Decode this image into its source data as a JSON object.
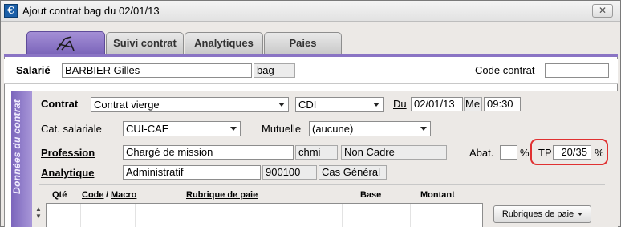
{
  "window": {
    "title": "Ajout contrat bag du 02/01/13",
    "icon_char": "€",
    "close_char": "✕"
  },
  "tabs": [
    {
      "label": "",
      "icon": "deckchair-icon"
    },
    {
      "label": "Suivi contrat"
    },
    {
      "label": "Analytiques"
    },
    {
      "label": "Paies"
    }
  ],
  "salarie": {
    "label": "Salarié",
    "name": "BARBIER Gilles",
    "code": "bag",
    "code_contrat_label": "Code contrat",
    "code_contrat_value": ""
  },
  "section_label": "Données du contrat",
  "contrat": {
    "label": "Contrat",
    "value": "Contrat vierge",
    "type": "CDI",
    "du_label": "Du",
    "du_date": "02/01/13",
    "du_day": "Me",
    "du_time": "09:30"
  },
  "cat_salariale": {
    "label": "Cat. salariale",
    "value": "CUI-CAE"
  },
  "mutuelle": {
    "label": "Mutuelle",
    "value": "(aucune)"
  },
  "profession": {
    "label": "Profession",
    "value": "Chargé de mission",
    "code": "chmi",
    "statut": "Non Cadre"
  },
  "abat": {
    "label": "Abat.",
    "value": "",
    "unit": "%"
  },
  "tp": {
    "label": "TP",
    "value": "20/35",
    "unit": "%"
  },
  "analytique": {
    "label": "Analytique",
    "value": "Administratif",
    "code": "900100",
    "type": "Cas Général"
  },
  "grid": {
    "columns": [
      {
        "label": "Qté",
        "underline": false
      },
      {
        "label": "Code",
        "underline": true
      },
      {
        "label": "/",
        "underline": false
      },
      {
        "label": "Macro",
        "underline": true
      },
      {
        "label": "Rubrique de paie",
        "underline": true
      },
      {
        "label": "Base",
        "underline": false
      },
      {
        "label": "Montant",
        "underline": false
      }
    ],
    "scroll_up": "▲",
    "scroll_down": "▼"
  },
  "rubriques_button": "Rubriques de paie",
  "colors": {
    "accent_purple": "#8a74c4",
    "highlight_red": "#e03131"
  }
}
